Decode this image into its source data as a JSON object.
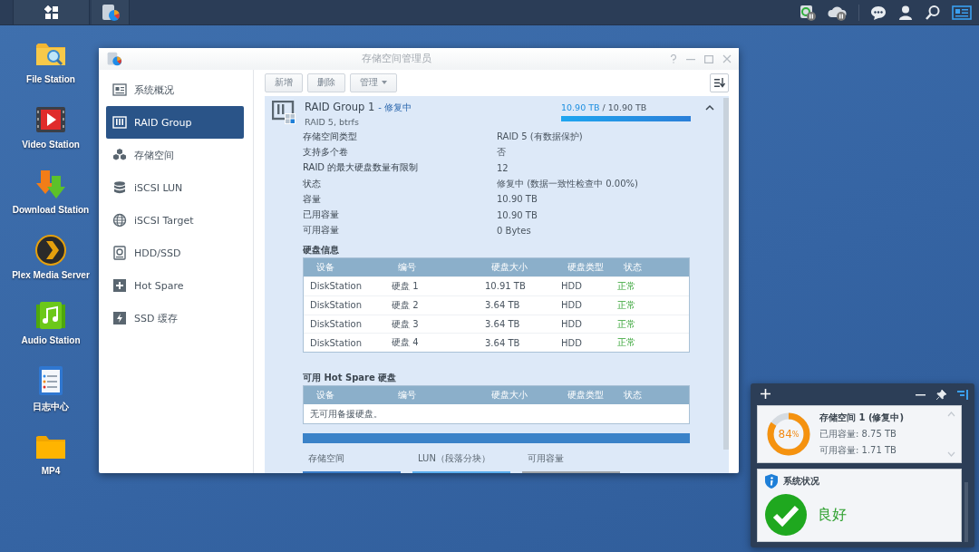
{
  "desktop_icons": [
    {
      "label": "File Station",
      "kind": "folder-search"
    },
    {
      "label": "Video Station",
      "kind": "video"
    },
    {
      "label": "Download Station",
      "kind": "download"
    },
    {
      "label": "Plex Media Server",
      "kind": "plex"
    },
    {
      "label": "Audio Station",
      "kind": "audio"
    },
    {
      "label": "日志中心",
      "kind": "log"
    },
    {
      "label": "MP4",
      "kind": "folder"
    }
  ],
  "window": {
    "title": "存储空间管理员",
    "sidebar": [
      {
        "label": "系统概况",
        "kind": "overview",
        "selected": false
      },
      {
        "label": "RAID Group",
        "kind": "raid",
        "selected": true
      },
      {
        "label": "存储空间",
        "kind": "cubes",
        "selected": false
      },
      {
        "label": "iSCSI LUN",
        "kind": "database",
        "selected": false
      },
      {
        "label": "iSCSI Target",
        "kind": "globe",
        "selected": false
      },
      {
        "label": "HDD/SSD",
        "kind": "disk",
        "selected": false
      },
      {
        "label": "Hot Spare",
        "kind": "plus",
        "selected": false
      },
      {
        "label": "SSD 缓存",
        "kind": "bolt",
        "selected": false
      }
    ],
    "toolbar": [
      {
        "label": "新增",
        "kind": "button"
      },
      {
        "label": "删除",
        "kind": "button"
      },
      {
        "label": "管理",
        "kind": "dropdown"
      }
    ],
    "raid_group": {
      "name": "RAID Group 1",
      "status": "- 修复中",
      "subtitle": "RAID 5, btrfs",
      "used": "10.90 TB",
      "total": "/ 10.90 TB",
      "level": 1,
      "expanded": true,
      "properties": [
        {
          "label": "存储空间类型",
          "value": "RAID 5 (有数据保护)"
        },
        {
          "label": "支持多个卷",
          "value": "否"
        },
        {
          "label": "RAID 的最大硬盘数量有限制",
          "value": "12"
        },
        {
          "label": "状态",
          "value": "修复中 (数据一致性检查中 0.00%)"
        },
        {
          "label": "容量",
          "value": "10.90 TB"
        },
        {
          "label": "已用容量",
          "value": "10.90 TB"
        },
        {
          "label": "可用容量",
          "value": "0 Bytes"
        }
      ],
      "disk_title": "硬盘信息",
      "disk_table": {
        "columns": [
          "设备",
          "编号",
          "硬盘大小",
          "硬盘类型",
          "状态"
        ],
        "rows": [
          {
            "cells": [
              "DiskStation",
              "硬盘 1",
              "10.91 TB",
              "HDD",
              "正常"
            ],
            "healthy": true
          },
          {
            "cells": [
              "DiskStation",
              "硬盘 2",
              "3.64 TB",
              "HDD",
              "正常"
            ],
            "healthy": true
          },
          {
            "cells": [
              "DiskStation",
              "硬盘 3",
              "3.64 TB",
              "HDD",
              "正常"
            ],
            "healthy": true
          },
          {
            "cells": [
              "DiskStation",
              "硬盘 4",
              "3.64 TB",
              "HDD",
              "正常"
            ],
            "healthy": true
          }
        ]
      },
      "hot_spare_title": "可用 Hot Spare 硬盘",
      "hot_spare_table": {
        "columns": [
          "设备",
          "编号",
          "硬盘大小",
          "硬盘类型",
          "状态"
        ],
        "empty_message": "无可用备援硬盘。"
      },
      "bottom_tabs": [
        {
          "label": "存储空间",
          "color": "#3a7cc8"
        },
        {
          "label": "LUN（段落分块）",
          "color": "#5aaeee"
        },
        {
          "label": "可用容量",
          "color": "#a0a4a8"
        }
      ]
    }
  },
  "widget": {
    "storage": {
      "title": "存储空间 1 (修复中)",
      "used": "已用容量: 8.75 TB",
      "free": "可用容量: 1.71 TB",
      "percent": "84",
      "percent_sign": "%",
      "level": 0.84
    },
    "system_status": {
      "title": "系统状况",
      "status": "良好",
      "healthy": true
    }
  }
}
